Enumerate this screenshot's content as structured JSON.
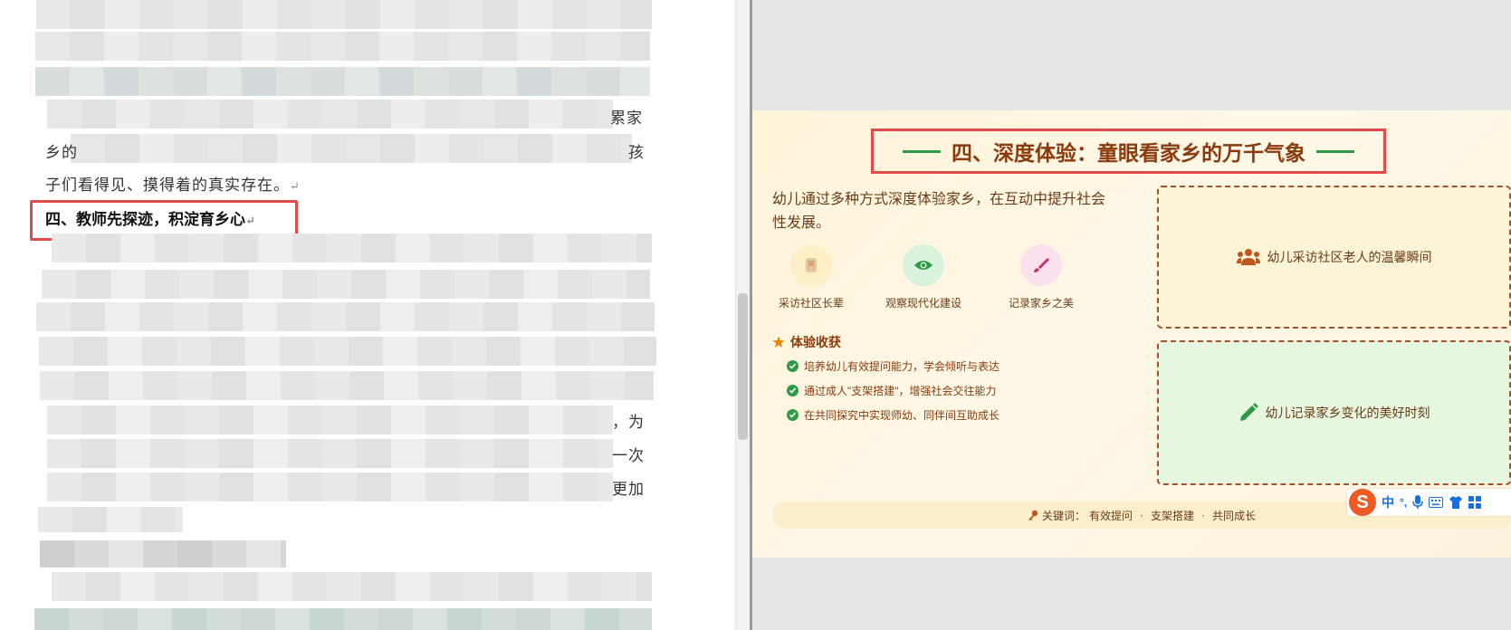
{
  "document": {
    "lines": [
      {
        "tail": "累家"
      },
      {
        "head": "乡的",
        "tail": "孩"
      },
      {
        "text": "子们看得见、摸得着的真实存在。"
      },
      {
        "tail": "，为"
      },
      {
        "tail": "一次"
      },
      {
        "tail": "更加"
      }
    ],
    "heading": "四、教师先探迹，积淀育乡心",
    "para_mark": "↵"
  },
  "slide": {
    "title": "四、深度体验：童眼看家乡的万千气象",
    "intro": "幼儿通过多种方式深度体验家乡，在互动中提升社会性发展。",
    "activities": [
      {
        "label": "采访社区长辈",
        "icon": "elder-photo-icon"
      },
      {
        "label": "观察现代化建设",
        "icon": "eye-icon"
      },
      {
        "label": "记录家乡之美",
        "icon": "paintbrush-icon"
      }
    ],
    "gains_title": "体验收获",
    "gains": [
      "培养幼儿有效提问能力，学会倾听与表达",
      "通过成人\"支架搭建\"，增强社会交往能力",
      "在共同探究中实现师幼、同伴间互助成长"
    ],
    "photo_placeholders": [
      {
        "label": "幼儿采访社区老人的温馨瞬间",
        "icon": "users-icon"
      },
      {
        "label": "幼儿记录家乡变化的美好时刻",
        "icon": "pencil-icon"
      }
    ],
    "keywords_label": "关键词：",
    "keywords": [
      "有效提问",
      "支架搭建",
      "共同成长"
    ],
    "keyword_sep": "·"
  },
  "ime": {
    "logo": "S",
    "mode": "中",
    "punct": "°,"
  },
  "colors": {
    "accent_red": "#e24a4a",
    "title_brown": "#8a3a0c",
    "green": "#2e9a45"
  }
}
